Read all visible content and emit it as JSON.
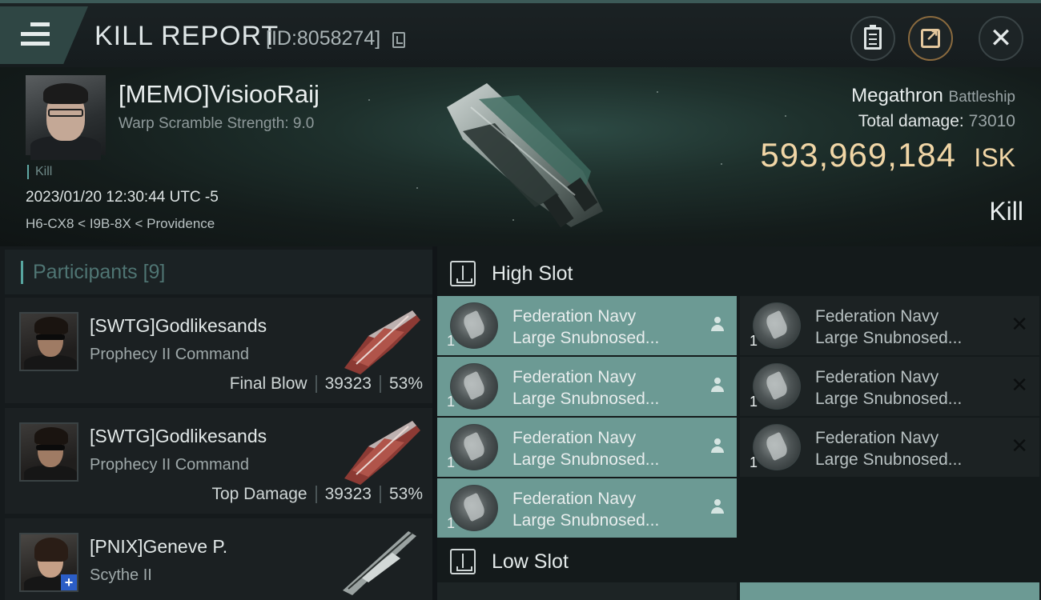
{
  "header": {
    "title": "KILL REPORT",
    "report_id": "[ID:8058274]"
  },
  "victim": {
    "name": "[MEMO]VisiooRaij",
    "subtitle": "Warp Scramble Strength: 9.0",
    "kill_tag": "Kill",
    "datetime": "2023/01/20 12:30:44 UTC -5",
    "location": "H6-CX8 < I9B-8X < Providence",
    "ship": "Megathron",
    "ship_class": "Battleship",
    "total_damage_label": "Total damage:",
    "total_damage": "73010",
    "isk_value": "593,969,184",
    "isk_unit": "ISK",
    "result": "Kill"
  },
  "participants": {
    "label": "Participants",
    "count": "[9]",
    "rows": [
      {
        "name": "[SWTG]Godlikesands",
        "ship": "Prophecy II Command",
        "role": "Final Blow",
        "damage": "39323",
        "percent": "53%"
      },
      {
        "name": "[SWTG]Godlikesands",
        "ship": "Prophecy II Command",
        "role": "Top Damage",
        "damage": "39323",
        "percent": "53%"
      },
      {
        "name": "[PNIX]Geneve P.",
        "ship": "Scythe II",
        "role": "",
        "damage": "",
        "percent": ""
      }
    ]
  },
  "fitting": {
    "high_slot_label": "High Slot",
    "low_slot_label": "Low Slot",
    "high_slot": [
      {
        "line1": "Federation Navy",
        "line2": "Large Snubnosed...",
        "qty": "1",
        "status": "dropped"
      },
      {
        "line1": "Federation Navy",
        "line2": "Large Snubnosed...",
        "qty": "1",
        "status": "destroyed"
      },
      {
        "line1": "Federation Navy",
        "line2": "Large Snubnosed...",
        "qty": "1",
        "status": "dropped"
      },
      {
        "line1": "Federation Navy",
        "line2": "Large Snubnosed...",
        "qty": "1",
        "status": "destroyed"
      },
      {
        "line1": "Federation Navy",
        "line2": "Large Snubnosed...",
        "qty": "1",
        "status": "dropped"
      },
      {
        "line1": "Federation Navy",
        "line2": "Large Snubnosed...",
        "qty": "1",
        "status": "destroyed"
      },
      {
        "line1": "Federation Navy",
        "line2": "Large Snubnosed...",
        "qty": "1",
        "status": "dropped"
      }
    ],
    "destroyed_mark": "✕"
  },
  "colors": {
    "accent_teal": "#58a6a0",
    "isk_gold": "#f1d6a6",
    "dropped_bg": "#6c9a94"
  },
  "icons": [
    "menu-icon",
    "clipboard-icon",
    "share-icon",
    "close-icon",
    "copy-icon",
    "slot-icon",
    "person-icon"
  ]
}
